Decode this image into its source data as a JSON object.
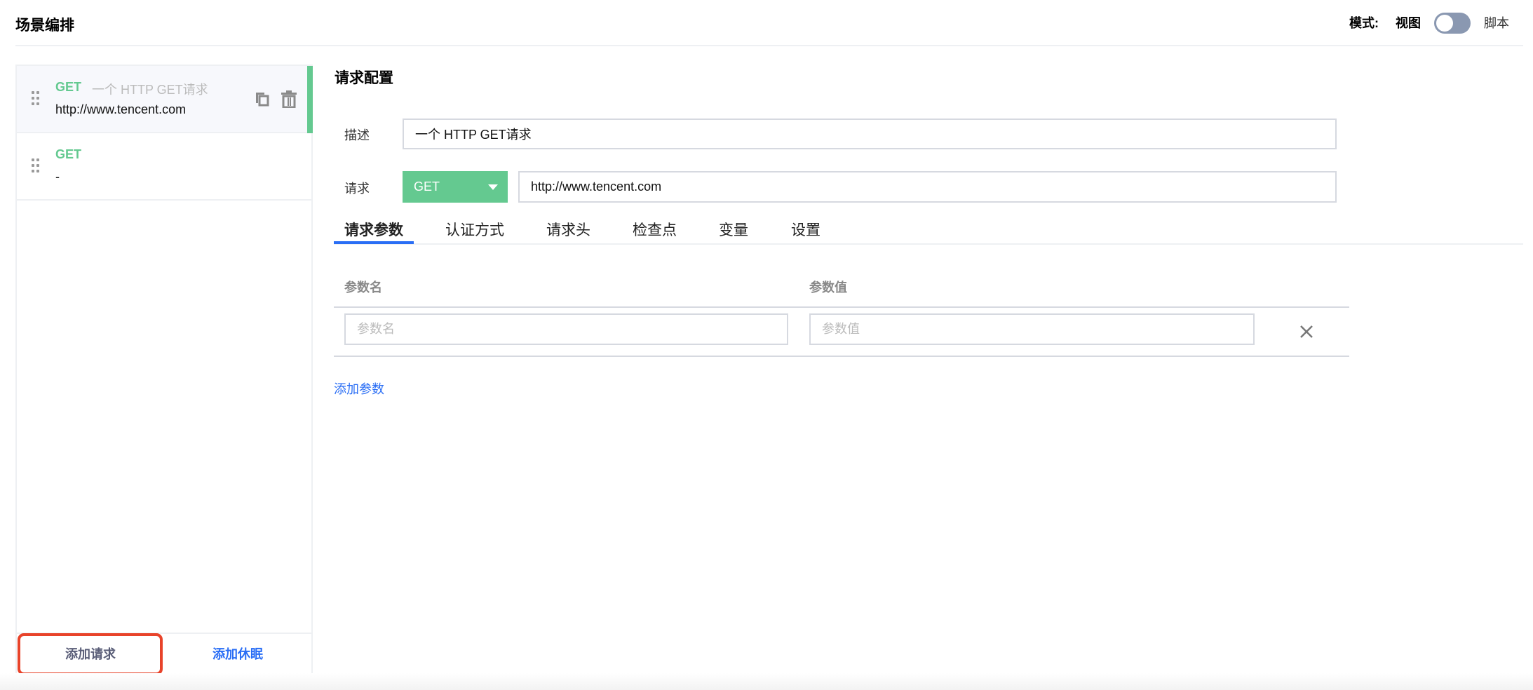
{
  "header": {
    "title": "场景编排",
    "mode_label": "模式:",
    "mode_view": "视图",
    "mode_script": "脚本",
    "toggle_on": false
  },
  "sidebar": {
    "items": [
      {
        "method": "GET",
        "description": "一个 HTTP GET请求",
        "url": "http://www.tencent.com",
        "active": true
      },
      {
        "method": "GET",
        "description": "",
        "url": "-",
        "active": false
      }
    ],
    "add_request": "添加请求",
    "add_sleep": "添加休眠"
  },
  "main": {
    "title": "请求配置",
    "desc_label": "描述",
    "desc_value": "一个 HTTP GET请求",
    "request_label": "请求",
    "method": "GET",
    "url_value": "http://www.tencent.com",
    "tabs": [
      {
        "label": "请求参数"
      },
      {
        "label": "认证方式"
      },
      {
        "label": "请求头"
      },
      {
        "label": "检查点"
      },
      {
        "label": "变量"
      },
      {
        "label": "设置"
      }
    ],
    "table": {
      "col_name": "参数名",
      "col_value": "参数值",
      "name_placeholder": "参数名",
      "value_placeholder": "参数值"
    },
    "add_param": "添加参数"
  },
  "colors": {
    "green": "#64c990",
    "blue": "#2a6ef5",
    "highlight": "#e8432a"
  }
}
